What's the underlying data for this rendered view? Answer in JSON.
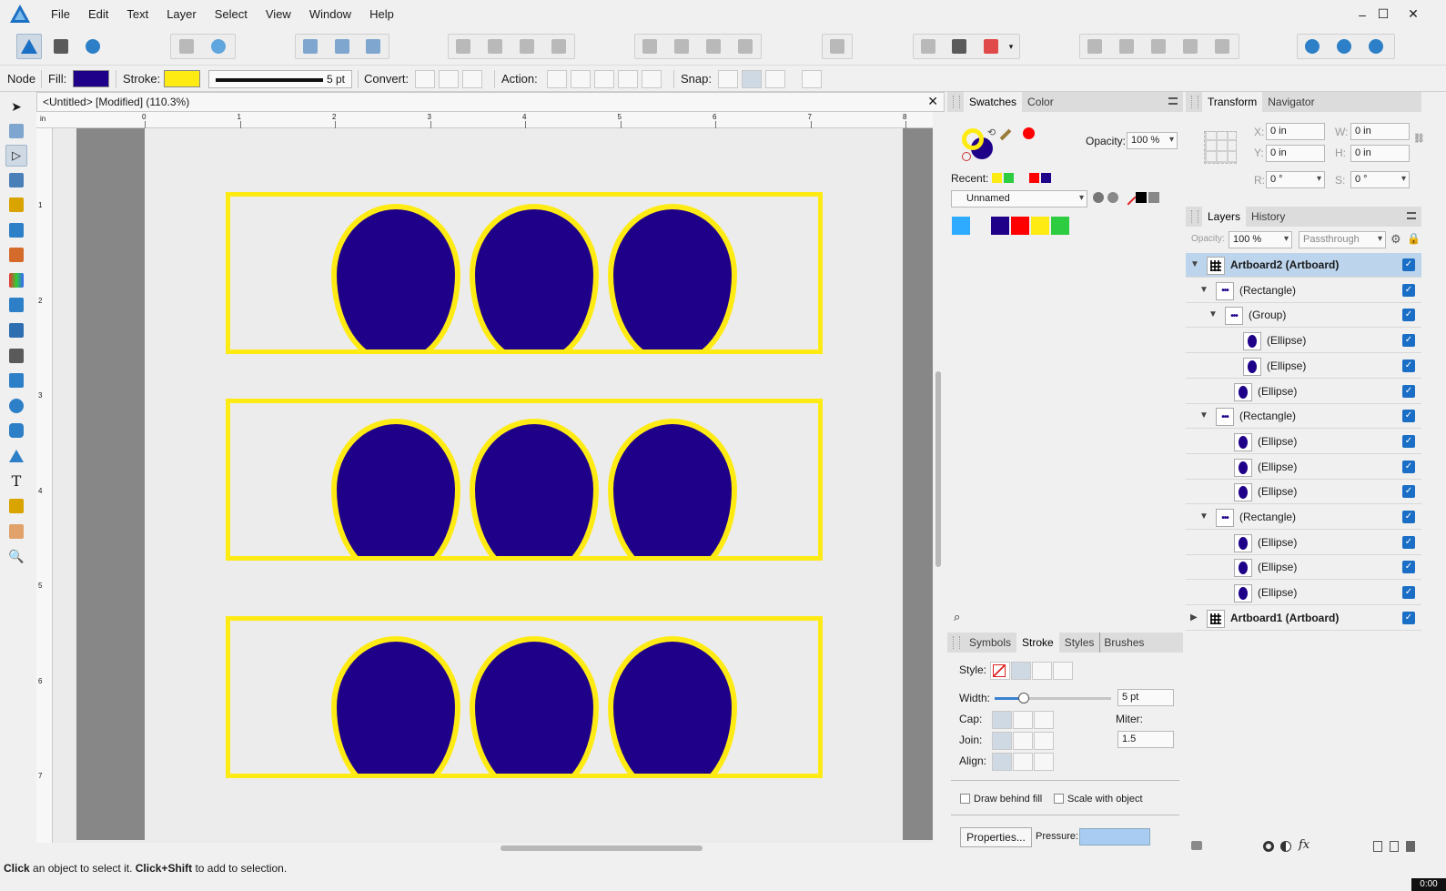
{
  "menu": [
    "File",
    "Edit",
    "Text",
    "Layer",
    "Select",
    "View",
    "Window",
    "Help"
  ],
  "window_controls": {
    "minimize": "–",
    "maximize": "☐",
    "close": "✕"
  },
  "context": {
    "mode": "Node",
    "fill_label": "Fill:",
    "fill_color": "#1f0088",
    "stroke_label": "Stroke:",
    "stroke_color": "#ffeb14",
    "stroke_width": "5 pt",
    "convert_label": "Convert:",
    "action_label": "Action:",
    "snap_label": "Snap:"
  },
  "document": {
    "tab_title": "<Untitled> [Modified] (110.3%)",
    "close": "✕"
  },
  "ruler": {
    "unit": "in",
    "h_ticks": [
      "0",
      "1",
      "2",
      "3",
      "4",
      "5",
      "6",
      "7",
      "8"
    ],
    "v_ticks": [
      "1",
      "2",
      "3",
      "4",
      "5",
      "6",
      "7"
    ]
  },
  "swatches_panel": {
    "tabs": [
      "Swatches",
      "Color"
    ],
    "opacity_label": "Opacity:",
    "opacity": "100 %",
    "recent_label": "Recent:",
    "recent_colors": [
      "#ffeb14",
      "#2ecc40",
      "#ff0000",
      "#1f0088"
    ],
    "palette_name": "Unnamed",
    "palette_colors": [
      "#2eaaff",
      "#1f0088",
      "#ff0000",
      "#ffeb14",
      "#2ecc40"
    ]
  },
  "transform_panel": {
    "tabs": [
      "Transform",
      "Navigator"
    ],
    "x_label": "X:",
    "x": "0 in",
    "y_label": "Y:",
    "y": "0 in",
    "w_label": "W:",
    "w": "0 in",
    "h_label": "H:",
    "h": "0 in",
    "r_label": "R:",
    "r": "0 °",
    "s_label": "S:",
    "s": "0 °"
  },
  "layers_panel": {
    "tabs": [
      "Layers",
      "History"
    ],
    "opacity_label": "Opacity:",
    "opacity": "100 %",
    "blend": "Passthrough",
    "rows": [
      {
        "name": "Artboard2 (Artboard)",
        "level": 0,
        "kind": "artboard",
        "expanded": "▼",
        "selected": true
      },
      {
        "name": "(Rectangle)",
        "level": 1,
        "kind": "rect",
        "expanded": "▼",
        "selected": false
      },
      {
        "name": "(Group)",
        "level": 2,
        "kind": "group",
        "expanded": "▼",
        "selected": false
      },
      {
        "name": "(Ellipse)",
        "level": 3,
        "kind": "ellipse",
        "expanded": "",
        "selected": false
      },
      {
        "name": "(Ellipse)",
        "level": 3,
        "kind": "ellipse",
        "expanded": "",
        "selected": false
      },
      {
        "name": "(Ellipse)",
        "level": 2,
        "kind": "ellipse",
        "expanded": "",
        "selected": false
      },
      {
        "name": "(Rectangle)",
        "level": 1,
        "kind": "rect",
        "expanded": "▼",
        "selected": false
      },
      {
        "name": "(Ellipse)",
        "level": 2,
        "kind": "ellipse",
        "expanded": "",
        "selected": false
      },
      {
        "name": "(Ellipse)",
        "level": 2,
        "kind": "ellipse",
        "expanded": "",
        "selected": false
      },
      {
        "name": "(Ellipse)",
        "level": 2,
        "kind": "ellipse",
        "expanded": "",
        "selected": false
      },
      {
        "name": "(Rectangle)",
        "level": 1,
        "kind": "rect",
        "expanded": "▼",
        "selected": false
      },
      {
        "name": "(Ellipse)",
        "level": 2,
        "kind": "ellipse",
        "expanded": "",
        "selected": false
      },
      {
        "name": "(Ellipse)",
        "level": 2,
        "kind": "ellipse",
        "expanded": "",
        "selected": false
      },
      {
        "name": "(Ellipse)",
        "level": 2,
        "kind": "ellipse",
        "expanded": "",
        "selected": false
      },
      {
        "name": "Artboard1 (Artboard)",
        "level": 0,
        "kind": "artboard",
        "expanded": "▶",
        "selected": false
      }
    ]
  },
  "stroke_panel": {
    "tabs": [
      "Symbols",
      "Stroke",
      "Styles",
      "Brushes"
    ],
    "style_label": "Style:",
    "width_label": "Width:",
    "width": "5 pt",
    "cap_label": "Cap:",
    "join_label": "Join:",
    "align_label": "Align:",
    "miter_label": "Miter:",
    "miter": "1.5",
    "draw_behind": "Draw behind fill",
    "scale_with": "Scale with object",
    "properties": "Properties...",
    "pressure_label": "Pressure:"
  },
  "status": {
    "bold1": "Click",
    "text1": " an object to select it. ",
    "bold2": "Click+Shift",
    "text2": " to add to selection.",
    "timer": "0:00"
  }
}
